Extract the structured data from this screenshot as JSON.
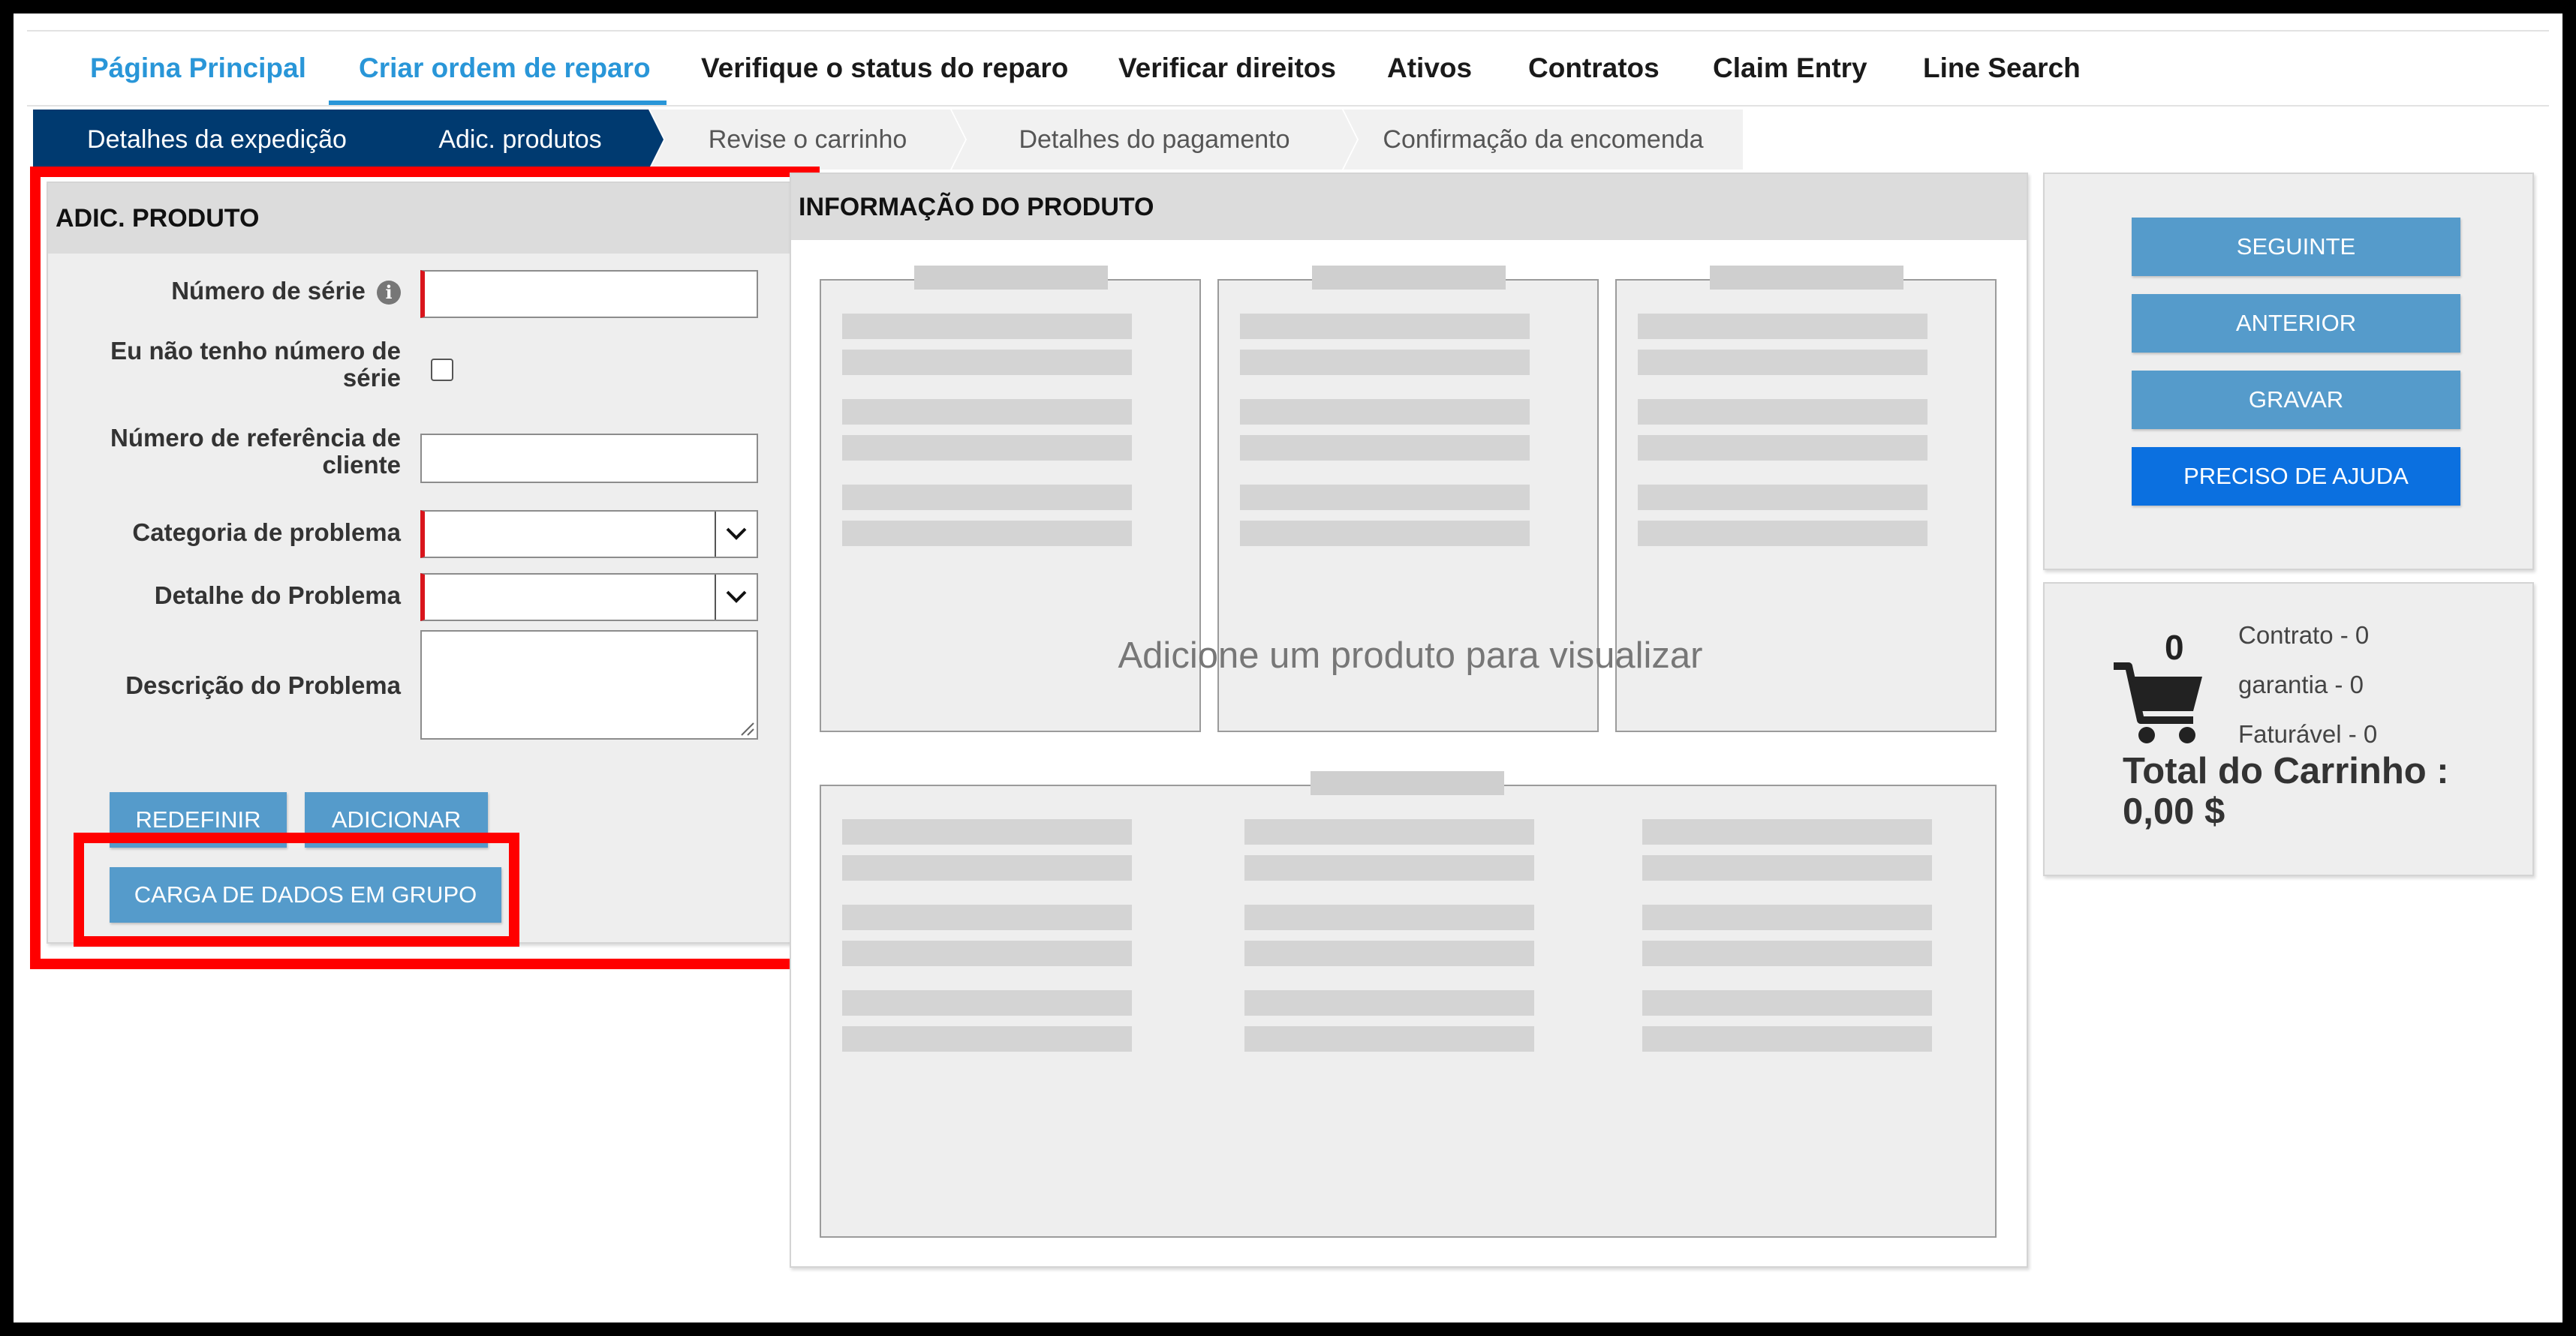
{
  "nav": {
    "items": [
      {
        "label": "Página Principal"
      },
      {
        "label": "Criar ordem de reparo"
      },
      {
        "label": "Verifique o status do reparo"
      },
      {
        "label": "Verificar direitos"
      },
      {
        "label": "Ativos"
      },
      {
        "label": "Contratos"
      },
      {
        "label": "Claim Entry"
      },
      {
        "label": "Line Search"
      }
    ],
    "active_index": 1
  },
  "wizard": {
    "steps": [
      {
        "label": "Detalhes da expedição",
        "state": "active"
      },
      {
        "label": "Adic. produtos",
        "state": "active"
      },
      {
        "label": "Revise o carrinho",
        "state": "inactive"
      },
      {
        "label": "Detalhes do pagamento",
        "state": "inactive"
      },
      {
        "label": "Confirmação da encomenda",
        "state": "inactive"
      }
    ]
  },
  "add_product": {
    "title": "ADIC. PRODUTO",
    "serial_label": "Número de série",
    "serial_value": "",
    "no_serial_label": "Eu não tenho número de série",
    "no_serial_checked": false,
    "customer_ref_label": "Número de referência de cliente",
    "customer_ref_value": "",
    "problem_category_label": "Categoria de problema",
    "problem_category_value": "",
    "problem_detail_label": "Detalhe do Problema",
    "problem_detail_value": "",
    "problem_description_label": "Descrição do Problema",
    "problem_description_value": "",
    "reset_button": "REDEFINIR",
    "add_button": "ADICIONAR",
    "bulk_upload_button": "CARGA DE DADOS EM GRUPO"
  },
  "product_info": {
    "title": "INFORMAÇÃO DO PRODUTO",
    "placeholder": "Adicione um produto para visualizar"
  },
  "actions": {
    "next": "SEGUINTE",
    "previous": "ANTERIOR",
    "save": "GRAVAR",
    "help": "PRECISO DE AJUDA"
  },
  "cart": {
    "count": "0",
    "contract": "Contrato - 0",
    "warranty": "garantia - 0",
    "billable": "Faturável - 0",
    "total_label": "Total do Carrinho :",
    "total_value": "0,00 $"
  },
  "colors": {
    "brand_blue": "#2996d8",
    "step_active": "#003a70",
    "button_blue": "#559bcb",
    "help_blue": "#0b70e0",
    "required_red": "#d9151c",
    "highlight_red": "#ff0000"
  }
}
